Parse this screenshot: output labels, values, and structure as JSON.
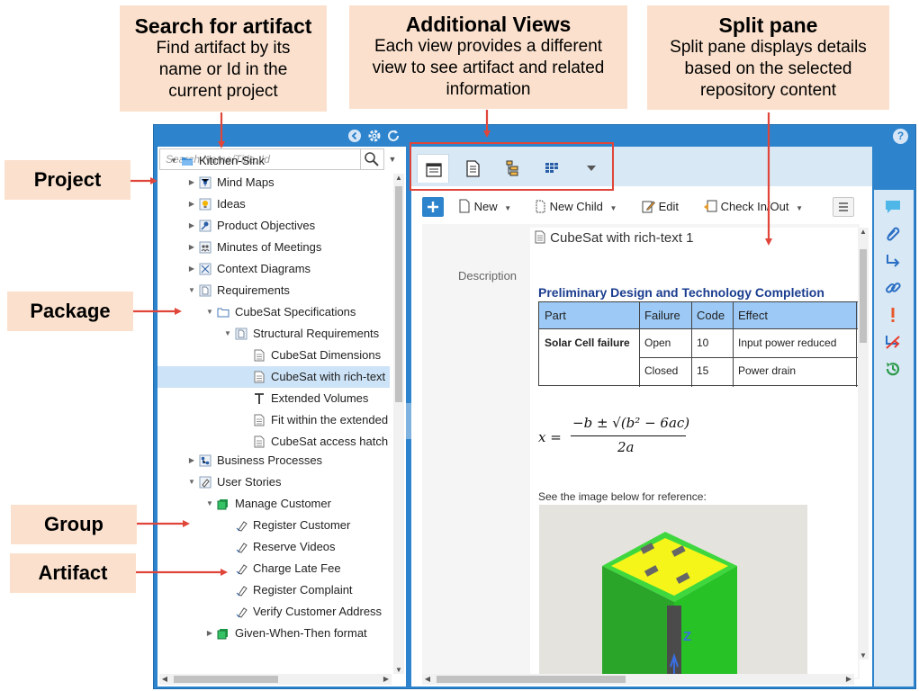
{
  "callouts": {
    "search": {
      "title": "Search for artifact",
      "desc": "Find artifact by its name or Id in the current project"
    },
    "views": {
      "title": "Additional Views",
      "desc": "Each view provides a different view to see artifact and related information"
    },
    "split": {
      "title": "Split pane",
      "desc": "Split pane displays details based on the selected repository content"
    }
  },
  "side_labels": {
    "project": "Project",
    "package": "Package",
    "group": "Group",
    "artifact": "Artifact"
  },
  "search": {
    "placeholder": "Search Name/Title, Id"
  },
  "tree": [
    {
      "label": "Kitchen-Sink",
      "icon": "folder-open-icon"
    },
    {
      "label": "Mind Maps",
      "icon": "mind-map-icon"
    },
    {
      "label": "Ideas",
      "icon": "lightbulb-icon"
    },
    {
      "label": "Product Objectives",
      "icon": "pin-icon"
    },
    {
      "label": "Minutes of Meetings",
      "icon": "meeting-icon"
    },
    {
      "label": "Context Diagrams",
      "icon": "diagram-icon"
    },
    {
      "label": "Requirements",
      "icon": "package-icon"
    },
    {
      "label": "CubeSat Specifications",
      "icon": "folder-icon"
    },
    {
      "label": "Structural Requirements",
      "icon": "package-icon"
    },
    {
      "label": "CubeSat Dimensions",
      "icon": "document-icon"
    },
    {
      "label": "CubeSat with rich-text",
      "icon": "document-icon"
    },
    {
      "label": "Extended Volumes",
      "icon": "text-icon"
    },
    {
      "label": "Fit within the extended",
      "icon": "document-icon"
    },
    {
      "label": "CubeSat access hatch",
      "icon": "document-icon"
    },
    {
      "label": "Business Processes",
      "icon": "process-icon"
    },
    {
      "label": "User Stories",
      "icon": "story-icon"
    },
    {
      "label": "Manage Customer",
      "icon": "group-icon"
    },
    {
      "label": "Register Customer",
      "icon": "story-card-icon"
    },
    {
      "label": "Reserve Videos",
      "icon": "story-card-icon"
    },
    {
      "label": "Charge Late Fee",
      "icon": "story-card-icon"
    },
    {
      "label": "Register Complaint",
      "icon": "story-card-icon"
    },
    {
      "label": "Verify Customer Address",
      "icon": "story-card-icon"
    },
    {
      "label": "Given-When-Then format",
      "icon": "group-icon"
    }
  ],
  "toolbar": {
    "new": "New",
    "new_child": "New Child",
    "edit": "Edit",
    "check": "Check In/Out"
  },
  "detail": {
    "artifact_title": "CubeSat with rich-text 1",
    "description_label": "Description",
    "section_heading": "Preliminary Design and Technology Completion",
    "table_headers": [
      "Part",
      "Failure",
      "Code",
      "Effect"
    ],
    "table_part": "Solar Cell failure",
    "table_rows": [
      {
        "failure": "Open",
        "code": "10",
        "effect": "Input power reduced"
      },
      {
        "failure": "Closed",
        "code": "15",
        "effect": "Power drain"
      }
    ],
    "formula_lhs": "x =",
    "formula_num": "−b ± √(b² − 6ac)",
    "formula_den": "2a",
    "image_caption": "See the image below for reference:",
    "axis_label": "Z"
  },
  "colors": {
    "frame": "#2d84cd",
    "callout": "#fbe1cd",
    "arrow": "#e0453a",
    "selected": "#cde3f7",
    "heading": "#1a3d8f"
  }
}
